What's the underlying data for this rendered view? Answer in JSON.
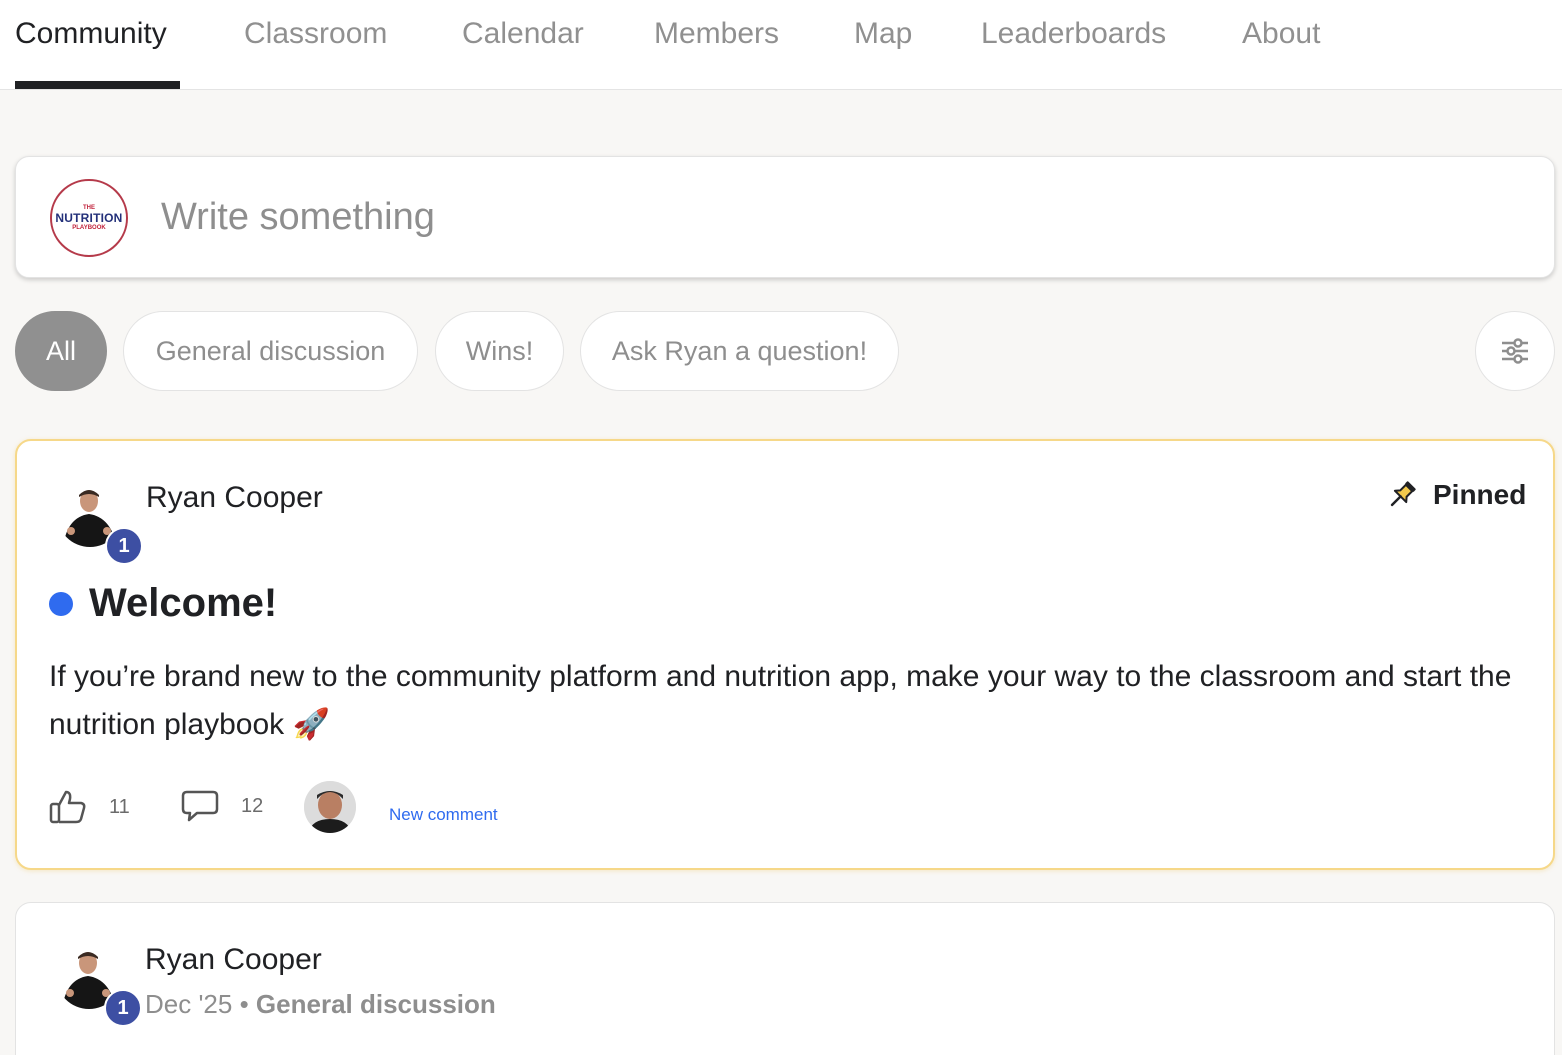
{
  "nav": {
    "tabs": [
      {
        "label": "Community"
      },
      {
        "label": "Classroom"
      },
      {
        "label": "Calendar"
      },
      {
        "label": "Members"
      },
      {
        "label": "Map"
      },
      {
        "label": "Leaderboards"
      },
      {
        "label": "About"
      }
    ]
  },
  "composer": {
    "placeholder": "Write something",
    "logo": {
      "small": "THE",
      "main": "NUTRITION",
      "sub": "PLAYBOOK"
    }
  },
  "filters": {
    "chips": [
      {
        "label": "All"
      },
      {
        "label": "General discussion"
      },
      {
        "label": "Wins!"
      },
      {
        "label": "Ask Ryan a question!"
      }
    ],
    "filter_icon": "sliders-icon"
  },
  "posts": [
    {
      "author": "Ryan Cooper",
      "level": "1",
      "pinned_label": "Pinned",
      "title": "Welcome!",
      "body": "If you’re brand new to the community platform and nutrition app, make your way to the classroom and start the nutrition playbook 🚀",
      "likes": "11",
      "comments": "12",
      "new_comment_label": "New comment",
      "accent": "#2f6bef"
    },
    {
      "author": "Ryan Cooper",
      "level": "1",
      "date": "Dec '25",
      "separator": "•",
      "category": "General discussion"
    }
  ],
  "colors": {
    "active_text": "#202124",
    "muted_text": "#909090",
    "badge": "#3d4fa3",
    "pinned_border": "#f6d889",
    "link": "#2f6bef"
  }
}
